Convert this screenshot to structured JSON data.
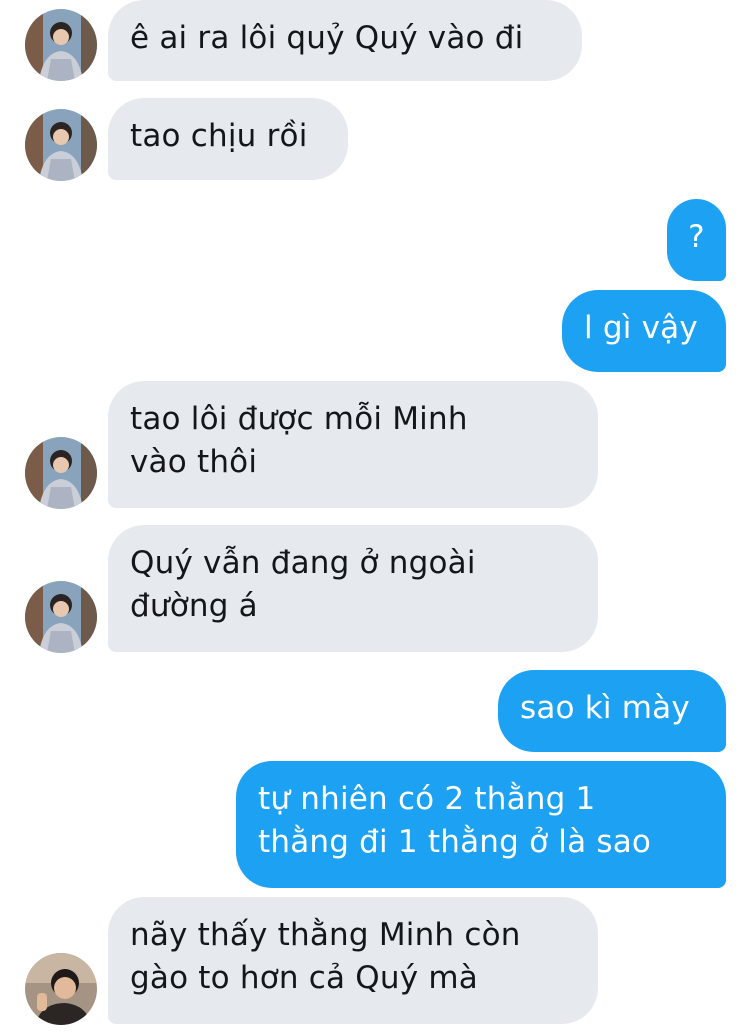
{
  "messages": [
    {
      "id": "m1",
      "side": "incoming",
      "lines": [
        "ê ai ra lôi quỷ Quý vào đi"
      ],
      "avatar": "avatar-icon"
    },
    {
      "id": "m2",
      "side": "incoming",
      "lines": [
        "tao chịu rồi"
      ],
      "avatar": "avatar-icon"
    },
    {
      "id": "m3",
      "side": "outgoing",
      "lines": [
        "?"
      ]
    },
    {
      "id": "m4",
      "side": "outgoing",
      "lines": [
        "l gì vậy"
      ]
    },
    {
      "id": "m5",
      "side": "incoming",
      "lines": [
        "tao lôi được mỗi Minh",
        "vào thôi"
      ],
      "avatar": "avatar-icon"
    },
    {
      "id": "m6",
      "side": "incoming",
      "lines": [
        "Quý vẫn đang ở ngoài",
        "đường á"
      ],
      "avatar": "avatar-icon"
    },
    {
      "id": "m7",
      "side": "outgoing",
      "lines": [
        "sao kì mày"
      ]
    },
    {
      "id": "m8",
      "side": "outgoing",
      "lines": [
        "tự nhiên có 2 thằng 1",
        "thằng đi 1 thằng ở là sao"
      ]
    },
    {
      "id": "m9",
      "side": "incoming",
      "lines": [
        "nãy thấy thằng Minh còn",
        "gào to hơn cả Quý mà"
      ],
      "avatar": "avatar-icon"
    }
  ],
  "colors": {
    "incoming_bubble": "#e6eaef",
    "outgoing_bubble": "#1da1f2",
    "incoming_text": "#14171a",
    "outgoing_text": "#ffffff"
  }
}
